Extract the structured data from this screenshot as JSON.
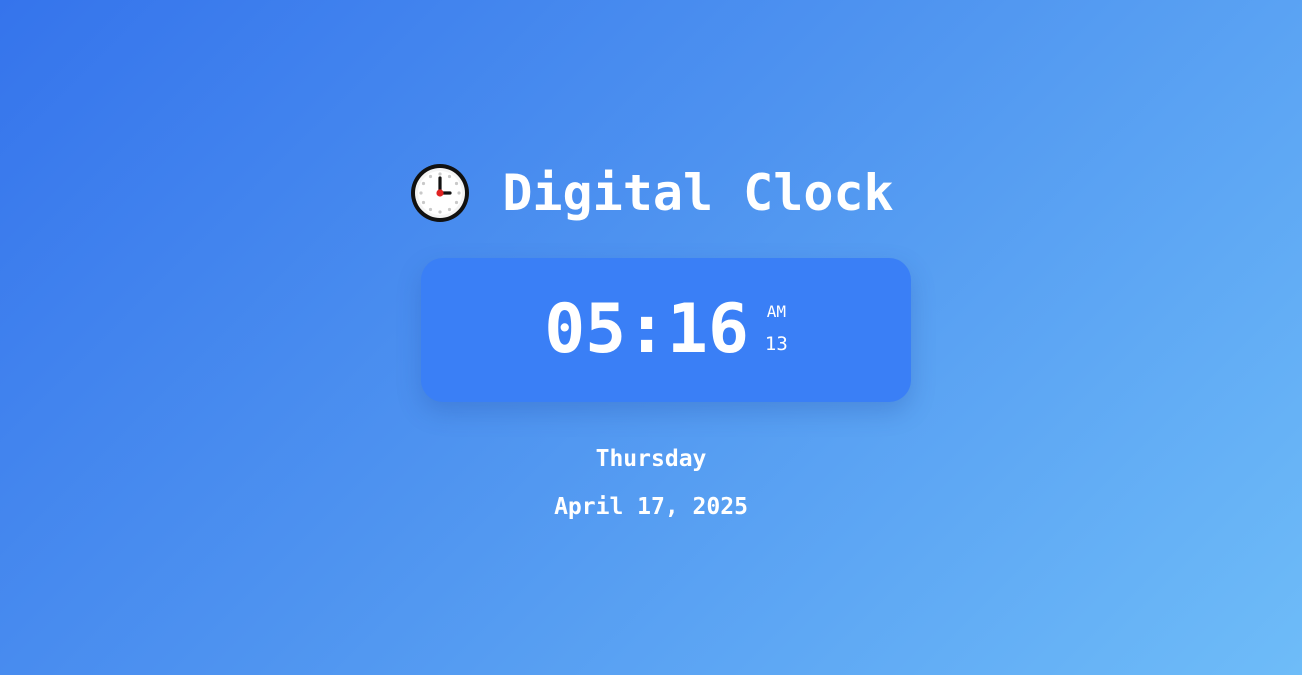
{
  "header": {
    "icon": "clock-icon",
    "title": "Digital Clock"
  },
  "clock": {
    "time": "05:16",
    "period": "AM",
    "seconds": "13"
  },
  "date": {
    "weekday": "Thursday",
    "full_date": "April 17, 2025"
  },
  "colors": {
    "background_start": "#3574ec",
    "background_end": "#6ebcf8",
    "card": "#3a7ff6",
    "text": "#ffffff"
  }
}
